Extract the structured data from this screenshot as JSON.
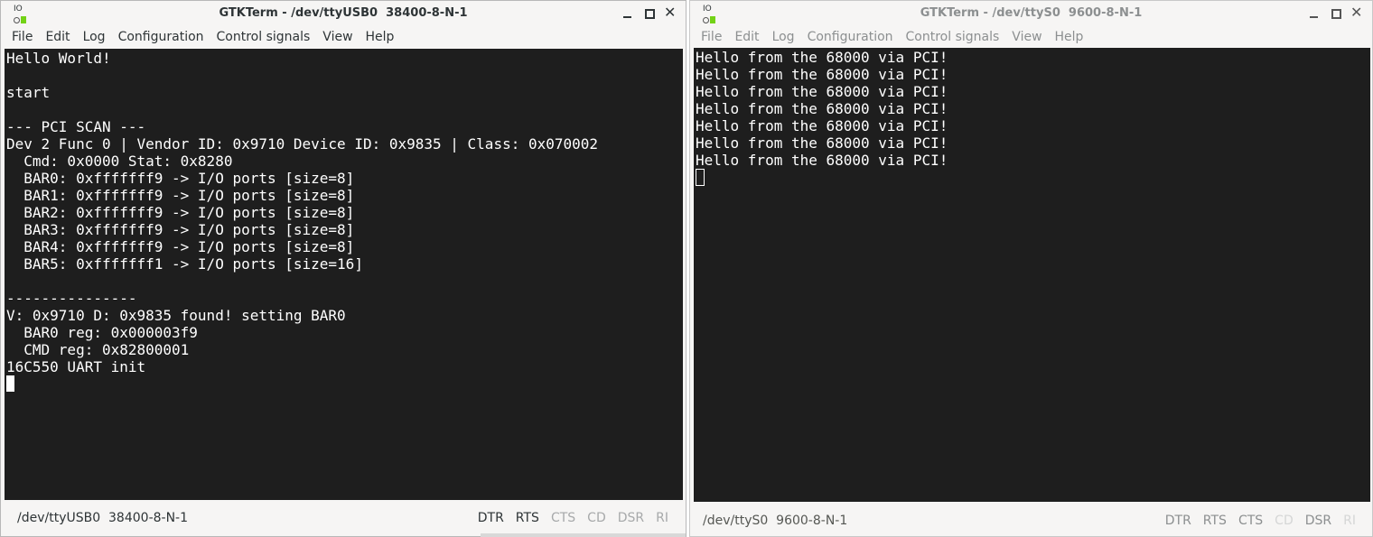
{
  "left_window": {
    "icon_label": "IO",
    "title": "GTKTerm - /dev/ttyUSB0  38400-8-N-1",
    "menu": [
      "File",
      "Edit",
      "Log",
      "Configuration",
      "Control signals",
      "View",
      "Help"
    ],
    "terminal_lines": [
      "Hello World!",
      "",
      "start",
      "",
      "--- PCI SCAN ---",
      "Dev 2 Func 0 | Vendor ID: 0x9710 Device ID: 0x9835 | Class: 0x070002",
      "  Cmd: 0x0000 Stat: 0x8280",
      "  BAR0: 0xfffffff9 -> I/O ports [size=8]",
      "  BAR1: 0xfffffff9 -> I/O ports [size=8]",
      "  BAR2: 0xfffffff9 -> I/O ports [size=8]",
      "  BAR3: 0xfffffff9 -> I/O ports [size=8]",
      "  BAR4: 0xfffffff9 -> I/O ports [size=8]",
      "  BAR5: 0xfffffff1 -> I/O ports [size=16]",
      "",
      "---------------",
      "V: 0x9710 D: 0x9835 found! setting BAR0",
      "  BAR0 reg: 0x000003f9",
      "  CMD reg: 0x82800001",
      "16C550 UART init"
    ],
    "status_port": "/dev/ttyUSB0  38400-8-N-1",
    "signals": [
      {
        "label": "DTR",
        "active": true
      },
      {
        "label": "RTS",
        "active": true
      },
      {
        "label": "CTS",
        "active": false
      },
      {
        "label": "CD",
        "active": false
      },
      {
        "label": "DSR",
        "active": false
      },
      {
        "label": "RI",
        "active": false
      }
    ]
  },
  "right_window": {
    "icon_label": "IO",
    "title": "GTKTerm - /dev/ttyS0  9600-8-N-1",
    "menu": [
      "File",
      "Edit",
      "Log",
      "Configuration",
      "Control signals",
      "View",
      "Help"
    ],
    "terminal_lines": [
      "Hello from the 68000 via PCI!",
      "Hello from the 68000 via PCI!",
      "Hello from the 68000 via PCI!",
      "Hello from the 68000 via PCI!",
      "Hello from the 68000 via PCI!",
      "Hello from the 68000 via PCI!",
      "Hello from the 68000 via PCI!"
    ],
    "status_port": "/dev/ttyS0  9600-8-N-1",
    "signals": [
      {
        "label": "DTR",
        "active": true
      },
      {
        "label": "RTS",
        "active": true
      },
      {
        "label": "CTS",
        "active": true
      },
      {
        "label": "CD",
        "active": false
      },
      {
        "label": "DSR",
        "active": true
      },
      {
        "label": "RI",
        "active": false
      }
    ]
  }
}
